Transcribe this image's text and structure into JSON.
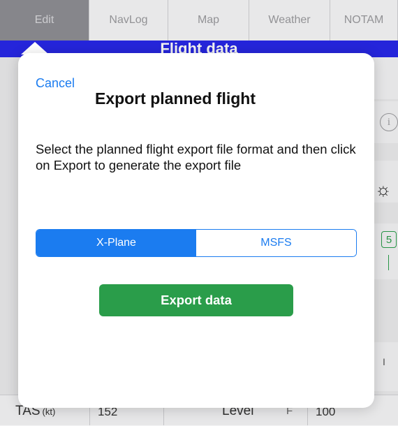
{
  "tabs": [
    {
      "label": "Edit",
      "active": true
    },
    {
      "label": "NavLog",
      "active": false
    },
    {
      "label": "Map",
      "active": false
    },
    {
      "label": "Weather",
      "active": false
    },
    {
      "label": "NOTAM",
      "active": false
    }
  ],
  "section_title": "Flight data",
  "modal": {
    "cancel_label": "Cancel",
    "title": "Export planned flight",
    "description": "Select the planned flight export file format and then click on Export to generate the export file",
    "formats": [
      {
        "label": "X-Plane",
        "selected": true
      },
      {
        "label": "MSFS",
        "selected": false
      }
    ],
    "export_button": "Export data"
  },
  "background_row": {
    "tas_label": "TAS",
    "tas_unit": "(kt)",
    "tas_value": "152",
    "level_label": "Level",
    "level_prefix": "F",
    "level_value": "100"
  },
  "right_edge": {
    "badge_value": "5",
    "edge_marker": "I"
  },
  "colors": {
    "accent_blue": "#1b7cf0",
    "band_blue": "#2828e6",
    "export_green": "#2a9d4a"
  }
}
